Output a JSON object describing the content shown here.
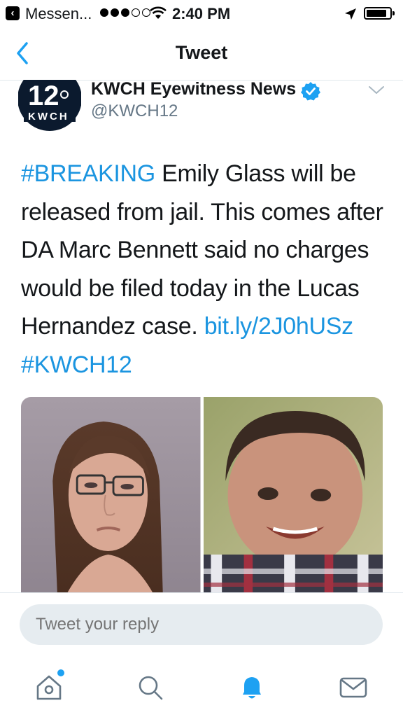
{
  "status_bar": {
    "back_app": "Messen...",
    "time": "2:40 PM"
  },
  "nav": {
    "title": "Tweet"
  },
  "tweet": {
    "account_name": "KWCH Eyewitness News",
    "handle": "@KWCH12",
    "avatar_logo_text": "12 KWCH",
    "text_segments": {
      "hashtag_breaking": "#BREAKING",
      "body": " Emily Glass will be released from jail. This comes after DA Marc Bennett said no charges would be filed today in the Lucas Hernandez case. ",
      "link": "bit.ly/2J0hUSz",
      "space": " ",
      "hashtag_kwch": "#KWCH12"
    },
    "media": [
      {
        "description": "mugshot photo"
      },
      {
        "description": "child photo"
      }
    ]
  },
  "reply": {
    "placeholder": "Tweet your reply"
  },
  "tab_bar": {
    "icons": [
      "home-icon",
      "search-icon",
      "notifications-icon",
      "messages-icon"
    ]
  },
  "colors": {
    "accent": "#1da1f2",
    "link": "#1b95e0",
    "text": "#14171a",
    "secondary": "#657786"
  }
}
